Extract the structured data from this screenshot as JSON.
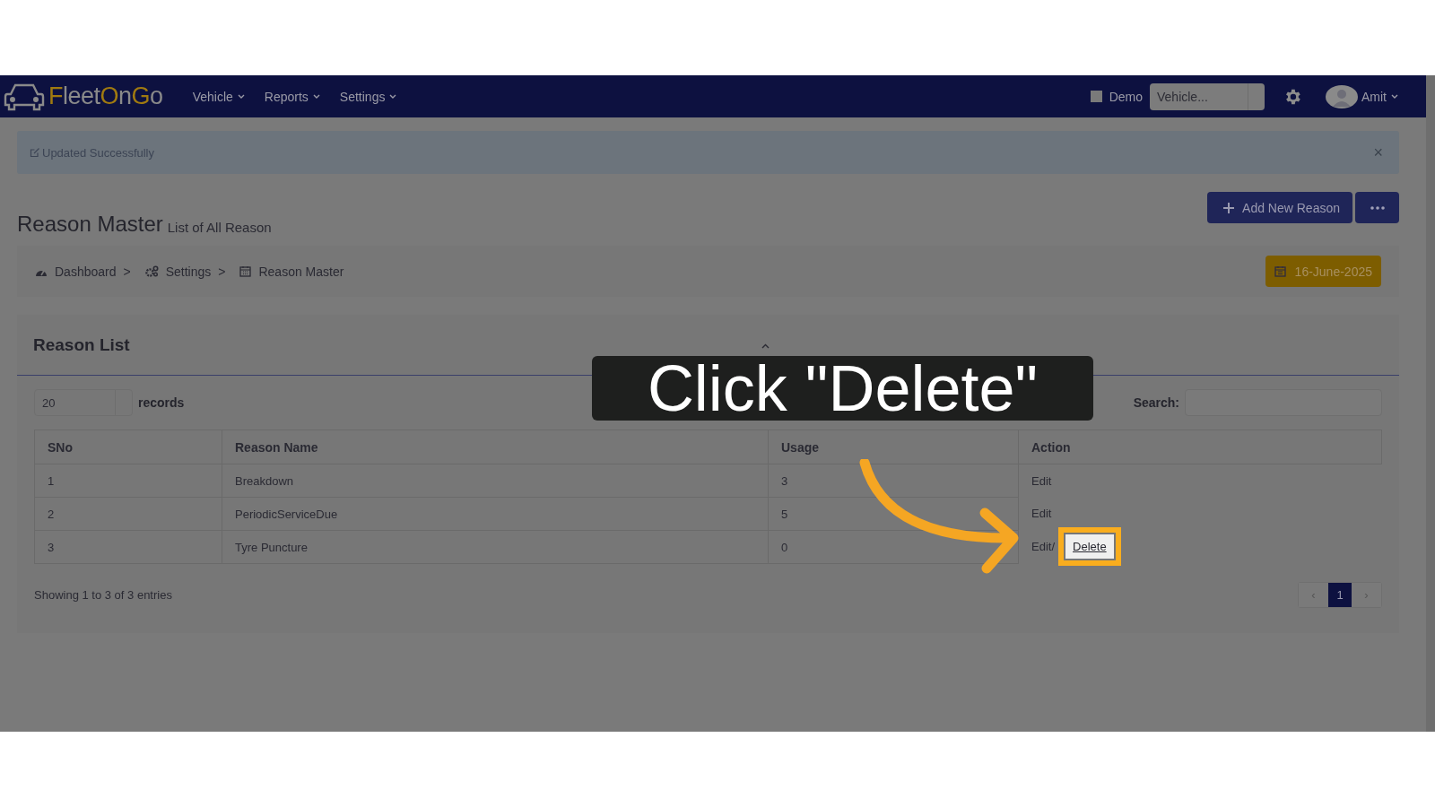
{
  "nav": {
    "logo": [
      {
        "text": "F",
        "accent": true
      },
      {
        "text": "leet",
        "accent": false
      },
      {
        "text": "O",
        "accent": true
      },
      {
        "text": "n",
        "accent": false
      },
      {
        "text": "G",
        "accent": true
      },
      {
        "text": "o",
        "accent": false
      }
    ],
    "menus": [
      "Vehicle",
      "Reports",
      "Settings"
    ],
    "demo": {
      "label": "Demo",
      "checked": false
    },
    "vehicle_select": {
      "placeholder": "Vehicle..."
    },
    "user": "Amit"
  },
  "alert": {
    "text": "Updated Successfully",
    "close": "×"
  },
  "header": {
    "title": "Reason Master",
    "subtitle": "List of All Reason",
    "add_button": "Add New Reason"
  },
  "breadcrumb": [
    {
      "label": "Dashboard",
      "separator": ">"
    },
    {
      "label": "Settings",
      "separator": ">"
    },
    {
      "label": "Reason Master"
    }
  ],
  "date_button": "16-June-2025",
  "card": {
    "title": "Reason List",
    "length": {
      "value": "20",
      "label": "records"
    },
    "search": {
      "label": "Search:"
    },
    "columns": [
      "SNo",
      "Reason Name",
      "Usage",
      "Action"
    ],
    "rows": [
      {
        "sno": "1",
        "name": "Breakdown",
        "usage": "3",
        "actions": [
          {
            "kind": "link",
            "label": "Edit",
            "highlighted": false
          }
        ]
      },
      {
        "sno": "2",
        "name": "PeriodicServiceDue",
        "usage": "5",
        "actions": [
          {
            "kind": "link",
            "label": "Edit",
            "highlighted": false
          }
        ]
      },
      {
        "sno": "3",
        "name": "Tyre Puncture",
        "usage": "0",
        "actions": [
          {
            "kind": "link",
            "label": "Edit",
            "highlighted": false
          },
          {
            "kind": "separator",
            "label": "/"
          },
          {
            "kind": "link",
            "label": "Delete",
            "highlighted": true
          }
        ]
      }
    ],
    "info": "Showing 1 to 3 of 3 entries",
    "pagination": [
      {
        "label": "‹",
        "selected": false
      },
      {
        "label": "1",
        "selected": true
      },
      {
        "label": "›",
        "selected": false
      }
    ]
  },
  "tutorial": {
    "callout": "Click \"Delete\""
  }
}
